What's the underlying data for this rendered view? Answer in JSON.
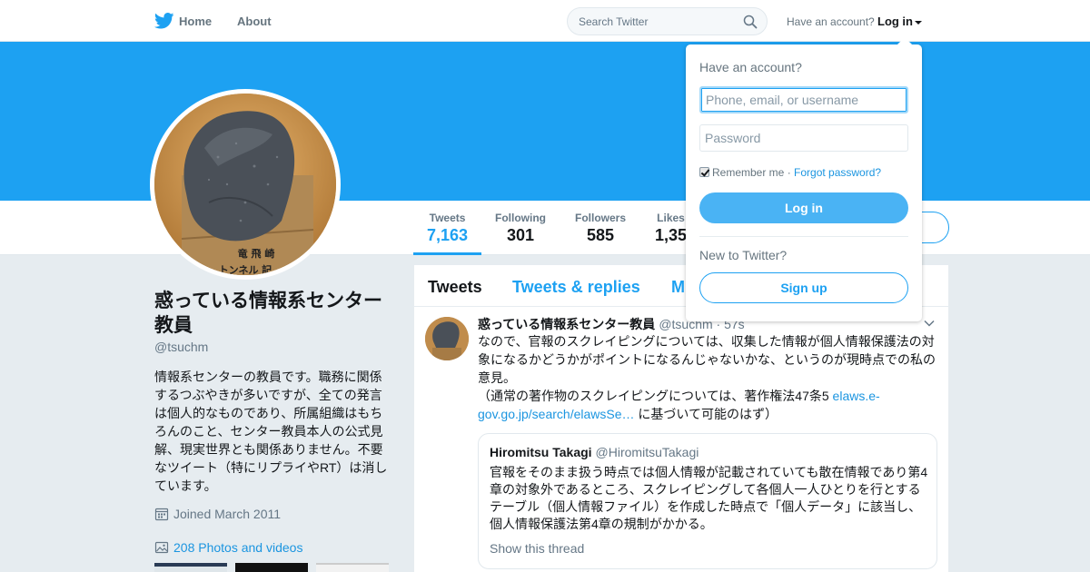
{
  "nav": {
    "home_label": "Home",
    "about_label": "About",
    "search_placeholder": "Search Twitter",
    "have_account": "Have an account?",
    "login_label": "Log in"
  },
  "profile": {
    "name": "惑っている情報系センター教員",
    "handle": "@tsuchm",
    "bio": "情報系センターの教員です。職務に関係するつぶやきが多いですが、全ての発言は個人的なものであり、所属組織はもちろんのこと、センター教員本人の公式見解、現実世界とも関係ありません。不要なツイート（特にリプライやRT）は消しています。",
    "avatar_caption": "竜 飛 崎\nトンネル 記",
    "joined": "Joined March 2011",
    "photos": "208 Photos and videos"
  },
  "stats": [
    {
      "label": "Tweets",
      "value": "7,163"
    },
    {
      "label": "Following",
      "value": "301"
    },
    {
      "label": "Followers",
      "value": "585"
    },
    {
      "label": "Likes",
      "value": "1,35"
    }
  ],
  "timeline": {
    "tabs": [
      "Tweets",
      "Tweets & replies",
      "M"
    ],
    "tweet": {
      "name": "惑っている情報系センター教員",
      "handle": "@tsuchm · 57s",
      "text_1": "なので、官報のスクレイピングについては、収集した情報が個人情報保護法の対象になるかどうかがポイントになるんじゃないかな、というのが現時点での私の意見。",
      "text_2": "（通常の著作物のスクレイピングについては、著作権法47条5 ",
      "link": "elaws.e-gov.go.jp/search/elawsSe…",
      "text_3": " に基づいて可能のはず）",
      "quote": {
        "name": "Hiromitsu Takagi",
        "handle": "@HiromitsuTakagi",
        "text": "官報をそのまま扱う時点では個人情報が記載されていても散在情報であり第4章の対象外であるところ、スクレイピングして各個人一人ひとりを行とするテーブル（個人情報ファイル）を作成した時点で「個人データ」に該当し、個人情報保護法第4章の規制がかかる。",
        "show_thread": "Show this thread"
      }
    }
  },
  "login_dropdown": {
    "title": "Have an account?",
    "username_placeholder": "Phone, email, or username",
    "password_placeholder": "Password",
    "remember_me": "Remember me",
    "separator": " · ",
    "forgot_password": "Forgot password?",
    "login_button": "Log in",
    "new_to_twitter": "New to Twitter?",
    "signup_button": "Sign up"
  },
  "colors": {
    "brand_blue": "#1da1f2",
    "banner": "#1da1f2",
    "link": "#1b95e0",
    "background": "#e6ecf0"
  }
}
